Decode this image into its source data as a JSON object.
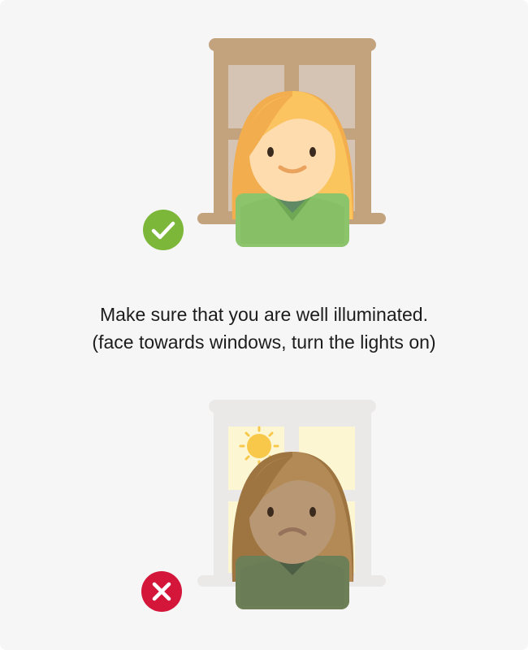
{
  "caption": {
    "line1": "Make sure that you are well illuminated.",
    "line2": "(face towards windows, turn the lights on)"
  },
  "good_example": {
    "status_icon": "checkmark-icon",
    "color": "#7cb73a"
  },
  "bad_example": {
    "status_icon": "cross-icon",
    "color": "#d3163a"
  }
}
